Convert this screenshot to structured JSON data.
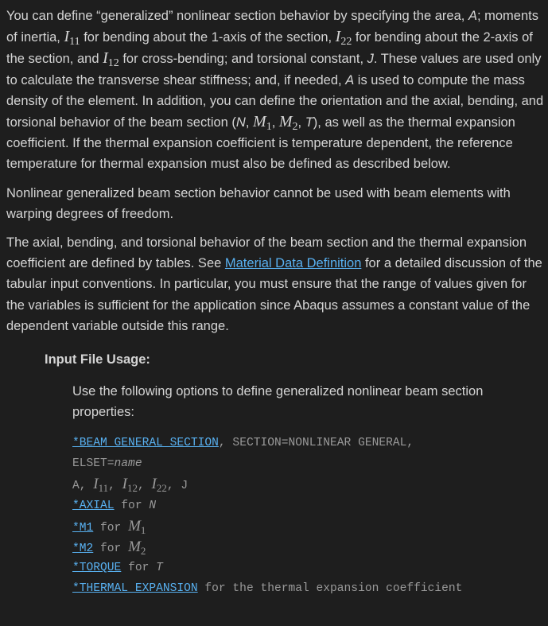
{
  "para1": {
    "t1": "You can define “generalized” nonlinear section behavior by specifying the area, ",
    "A": "A",
    "t2": "; moments of inertia, ",
    "I": "I",
    "s11": "11",
    "t3": " for bending about the 1-axis of the section, ",
    "s22": "22",
    "t4": " for bending about the 2-axis of the section, and ",
    "s12": "12",
    "t5": " for cross-bending; and torsional constant, ",
    "J": "J",
    "t6": ". These values are used only to calculate the transverse shear stiffness; and, if needed, ",
    "A2": "A",
    "t7": " is used to compute the mass density of the element. In addition, you can define the orientation and the axial, bending, and torsional behavior of the beam section (",
    "N": "N",
    "comma1": ", ",
    "M": "M",
    "s1": "1",
    "comma2": ", ",
    "s2": "2",
    "comma3": ", ",
    "T": "T",
    "t8": "), as well as the thermal expansion coefficient. If the thermal expansion coefficient is temperature dependent, the reference temperature for thermal expansion must also be defined as described below."
  },
  "para2": "Nonlinear generalized beam section behavior cannot be used with beam elements with warping degrees of freedom.",
  "para3": {
    "t1": "The axial, bending, and torsional behavior of the beam section and the thermal expansion coefficient are defined by tables. See ",
    "link": "Material Data Definition",
    "t2": " for a detailed discussion of the tabular input conventions. In particular, you must ensure that the range of values given for the variables is sufficient for the application since Abaqus assumes a constant value of the dependent variable outside this range."
  },
  "usage": {
    "heading": "Input File Usage:",
    "intro": "Use the following options to define generalized nonlinear beam section properties:",
    "code": {
      "l1_kw": "*BEAM GENERAL SECTION",
      "l1_rest": ", SECTION=NONLINEAR GENERAL,",
      "l2_pre": "ELSET=",
      "l2_var": "name",
      "l3_a": "A, ",
      "l3_I": "I",
      "l3_s11": "11",
      "l3_c1": ", ",
      "l3_s12": "12",
      "l3_c2": ", ",
      "l3_s22": "22",
      "l3_end": ", J",
      "l4_kw": "*AXIAL",
      "l4_rest": " for ",
      "l4_var": "N",
      "l5_kw": "*M1",
      "l5_rest": " for ",
      "l5_M": "M",
      "l5_sub": "1",
      "l6_kw": "*M2",
      "l6_rest": " for ",
      "l6_M": "M",
      "l6_sub": "2",
      "l7_kw": "*TORQUE",
      "l7_rest": " for ",
      "l7_var": "T",
      "l8_kw": "*THERMAL EXPANSION",
      "l8_rest": " for the thermal expansion coefficient"
    }
  }
}
